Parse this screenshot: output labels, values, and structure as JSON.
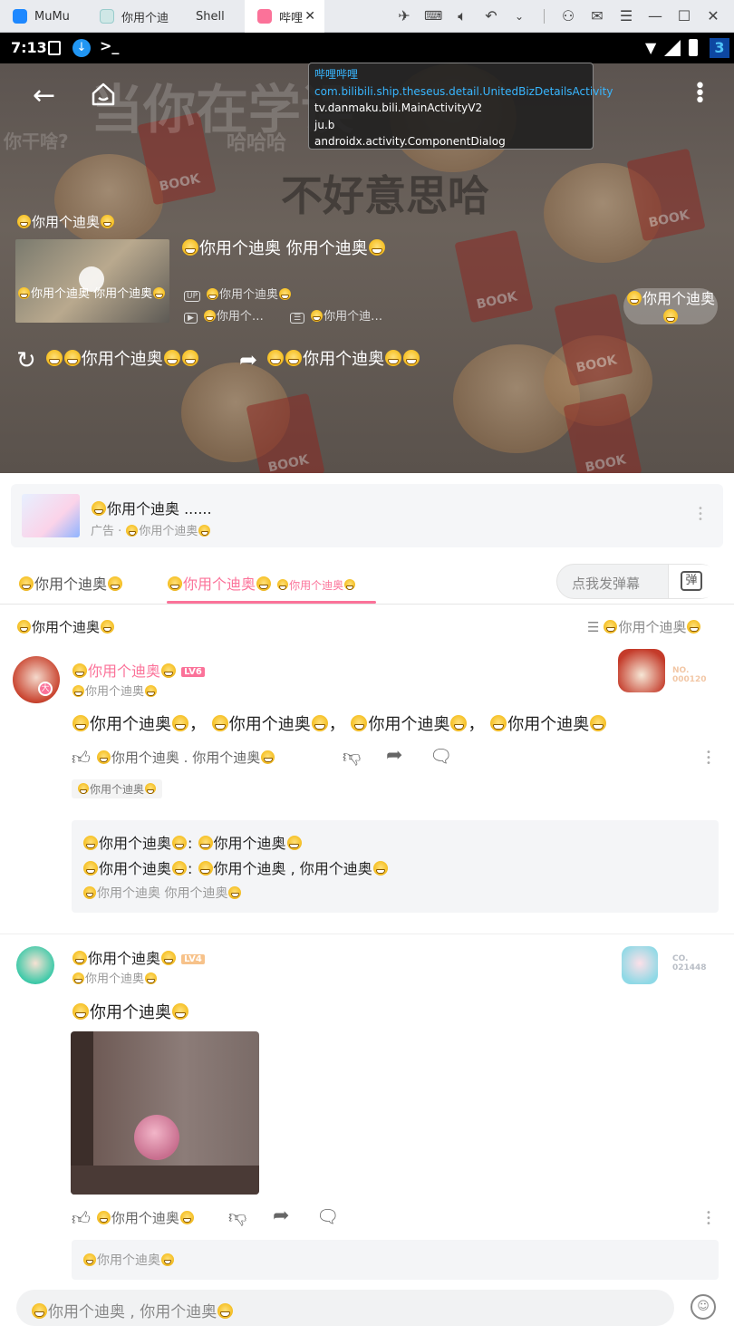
{
  "titlebar": {
    "tabs": [
      {
        "label": "MuMu",
        "color": "#1e88ff"
      },
      {
        "label": "你用个迪",
        "color": "#7bb"
      },
      {
        "label": "Shell",
        "color": ""
      },
      {
        "label": "哔哩",
        "color": "#fb7299"
      }
    ]
  },
  "statusbar": {
    "time": "7:13",
    "badge": "3"
  },
  "debug": {
    "app": "哔哩哔哩",
    "activities": [
      "com.bilibili.ship.theseus.detail.UnitedBizDetailsActivity",
      "tv.danmaku.bili.MainActivityV2",
      "ju.b",
      "androidx.activity.ComponentDialog"
    ]
  },
  "video": {
    "bg_text_1": "当你在学误",
    "bg_text_2": "不好意思哈",
    "bg_text_3": "哈哈哈",
    "bg_text_4": "你干啥?",
    "series_title": "你用个迪奥",
    "thumb_caption": "你用个迪奥 你用个迪奥",
    "main_title": "你用个迪奥  你用个迪奥",
    "up_name": "你用个迪奥",
    "play_count": "你用个…",
    "danmaku_count": "你用个迪…",
    "follow_label": "你用个迪奥",
    "replay_label": "你用个迪奥",
    "share_label": "你用个迪奥"
  },
  "ad": {
    "title": "你用个迪奥 ......",
    "sub_prefix": "广告 ·",
    "sub": "你用个迪奥"
  },
  "tabs": {
    "intro": "你用个迪奥",
    "comments": "你用个迪奥",
    "comments_count": "你用个迪奥",
    "danmaku_placeholder": "点我发弹幕",
    "danmaku_btn": "弹"
  },
  "comments_header": {
    "title": "你用个迪奥",
    "sort": "你用个迪奥"
  },
  "comment1": {
    "user": "你用个迪奥",
    "level": "LV6",
    "time": "你用个迪奥",
    "badge_no": "NO.",
    "badge_num": "000120",
    "text_segments": [
      "你用个迪奥",
      "你用个迪奥",
      "你用个迪奥",
      "你用个迪奥"
    ],
    "like_text": "你用个迪奥 . 你用个迪奥",
    "tag": "你用个迪奥",
    "replies": [
      {
        "user": "你用个迪奥",
        "text": "你用个迪奥"
      },
      {
        "user": "你用个迪奥",
        "text": "你用个迪奥 ,  你用个迪奥"
      }
    ],
    "more_replies": "你用个迪奥   你用个迪奥"
  },
  "comment2": {
    "user": "你用个迪奥",
    "level": "LV4",
    "time": "你用个迪奥",
    "badge_no": "CO.",
    "badge_num": "021448",
    "text": "你用个迪奥",
    "like_text": "你用个迪奥",
    "reply_box": "你用个迪奥"
  },
  "input": {
    "placeholder": "你用个迪奥 ,  你用个迪奥"
  }
}
